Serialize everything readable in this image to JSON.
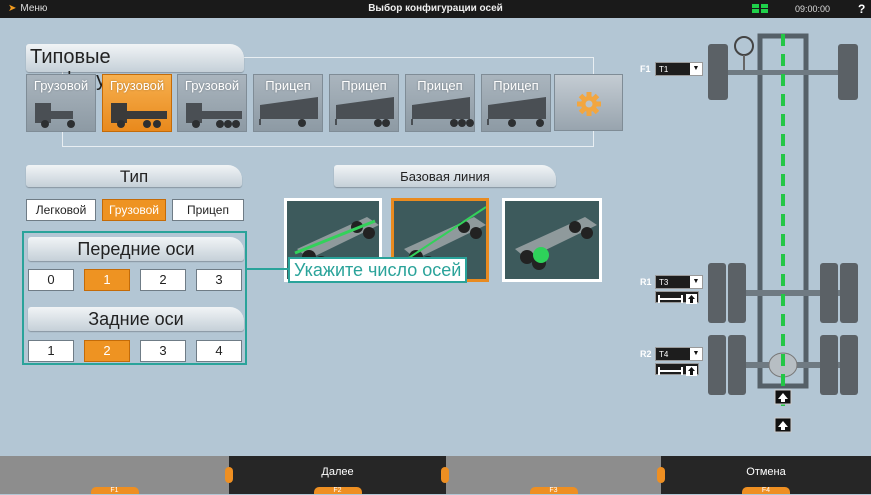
{
  "titlebar": {
    "menu": "Меню",
    "title": "Выбор конфигурации осей",
    "time": "09:00:00",
    "help": "?"
  },
  "presets": {
    "header": "Типовые конфигурации",
    "items": [
      {
        "label": "Грузовой",
        "selected": false
      },
      {
        "label": "Грузовой",
        "selected": true
      },
      {
        "label": "Грузовой",
        "selected": false
      },
      {
        "label": "Прицеп",
        "selected": false
      },
      {
        "label": "Прицеп",
        "selected": false
      },
      {
        "label": "Прицеп",
        "selected": false
      },
      {
        "label": "Прицеп",
        "selected": false
      }
    ]
  },
  "type": {
    "header": "Тип",
    "options": [
      "Легковой",
      "Грузовой",
      "Прицеп"
    ],
    "selected": "Грузовой"
  },
  "front_axles": {
    "header": "Передние оси",
    "options": [
      "0",
      "1",
      "2",
      "3"
    ],
    "selected": "1"
  },
  "rear_axles": {
    "header": "Задние оси",
    "options": [
      "1",
      "2",
      "3",
      "4"
    ],
    "selected": "2"
  },
  "baseline": {
    "header": "Базовая линия",
    "selected_index": 1
  },
  "hint": "Укажите число осей",
  "axle_panel": {
    "axles": [
      {
        "label": "F1",
        "value": "T1"
      },
      {
        "label": "R1",
        "value": "T3"
      },
      {
        "label": "R2",
        "value": "T4"
      }
    ]
  },
  "bottombar": {
    "keys": [
      {
        "label": "",
        "tab": "F1"
      },
      {
        "label": "Далее",
        "tab": "F2"
      },
      {
        "label": "",
        "tab": "F3"
      },
      {
        "label": "Отмена",
        "tab": "F4"
      }
    ]
  },
  "colors": {
    "accent": "#ee9322",
    "background": "#b3c6d4",
    "highlight": "#2aa39a",
    "status": "#1fd14a"
  }
}
